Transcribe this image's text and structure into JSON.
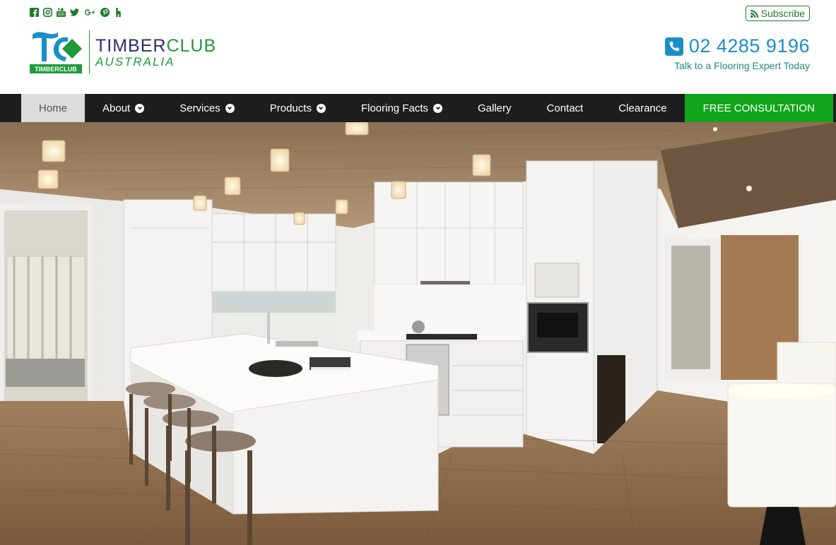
{
  "social": {
    "icons": [
      "facebook-icon",
      "instagram-icon",
      "youtube-icon",
      "twitter-icon",
      "google-plus-icon",
      "pinterest-icon",
      "houzz-icon"
    ]
  },
  "subscribe": {
    "label": "Subscribe",
    "icon": "rss-icon"
  },
  "logo": {
    "badge_text": "TIMBERCLUB",
    "title_part1": "TIMBER",
    "title_part2": "CLUB",
    "subtitle": "AUSTRALIA"
  },
  "contact": {
    "phone": "02 4285 9196",
    "tagline": "Talk to a Flooring Expert Today",
    "icon": "phone-icon"
  },
  "nav": {
    "items": [
      {
        "label": "Home",
        "active": true,
        "dropdown": false
      },
      {
        "label": "About",
        "dropdown": true
      },
      {
        "label": "Services",
        "dropdown": true
      },
      {
        "label": "Products",
        "dropdown": true
      },
      {
        "label": "Flooring Facts",
        "dropdown": true
      },
      {
        "label": "Gallery",
        "dropdown": false
      },
      {
        "label": "Contact",
        "dropdown": false
      },
      {
        "label": "Clearance",
        "dropdown": false
      }
    ],
    "cta": "FREE CONSULTATION"
  },
  "colors": {
    "brand_green": "#1f9a3a",
    "brand_navy": "#2a2f6a",
    "phone_blue": "#1a8fc7",
    "nav_bg": "#1e1e1e",
    "cta_green": "#12a51b"
  }
}
